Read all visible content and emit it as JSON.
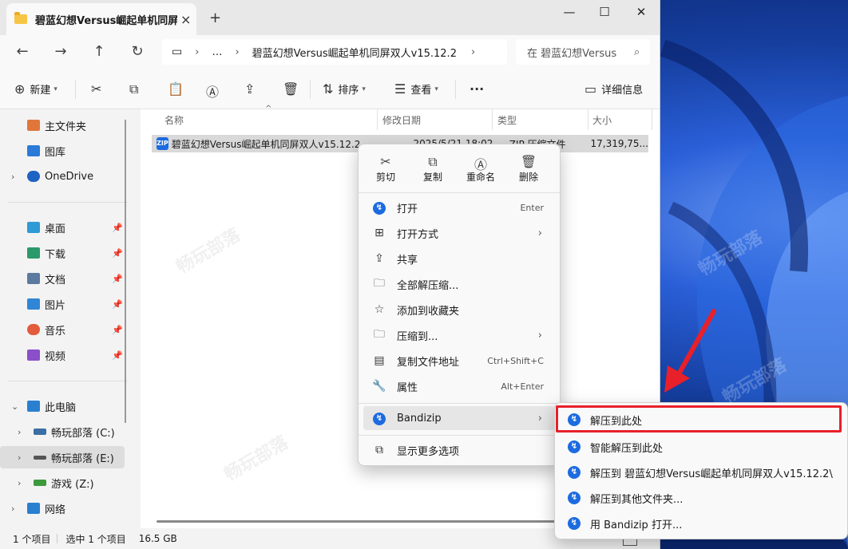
{
  "window": {
    "tab_title": "碧蓝幻想Versus崛起单机同屏双",
    "tab_close": "×",
    "new_tab": "+",
    "minimize": "—",
    "maximize": "☐",
    "close": "✕"
  },
  "address": {
    "ellipsis": "…",
    "path": "碧蓝幻想Versus崛起单机同屏双人v15.12.2",
    "search_placeholder": "在 碧蓝幻想Versus"
  },
  "toolbar": {
    "new_label": "新建",
    "sort_label": "排序",
    "view_label": "查看",
    "more": "···",
    "details_label": "详细信息"
  },
  "sidebar": {
    "items": [
      {
        "label": "主文件夹",
        "color": "#e0763a"
      },
      {
        "label": "图库",
        "color": "#2b7ad8"
      },
      {
        "label": "OneDrive",
        "color": "#1e63c4"
      },
      {
        "label": "桌面",
        "color": "#2e9ad6"
      },
      {
        "label": "下载",
        "color": "#2a9a6a"
      },
      {
        "label": "文档",
        "color": "#5c7aa0"
      },
      {
        "label": "图片",
        "color": "#2f86d6"
      },
      {
        "label": "音乐",
        "color": "#e25b3d"
      },
      {
        "label": "视频",
        "color": "#8a4fc9"
      },
      {
        "label": "此电脑",
        "color": "#2a7fd0"
      },
      {
        "label": "畅玩部落 (C:)",
        "color": "#3b6ea5"
      },
      {
        "label": "畅玩部落 (E:)",
        "color": "#555555"
      },
      {
        "label": "游戏 (Z:)",
        "color": "#3c9a3c"
      },
      {
        "label": "网络",
        "color": "#2a7fd0"
      }
    ]
  },
  "columns": {
    "name": "名称",
    "modified": "修改日期",
    "type": "类型",
    "size": "大小"
  },
  "file": {
    "name": "碧蓝幻想Versus崛起单机同屏双人v15.12.2",
    "modified": "2025/5/21 18:02",
    "type": "ZIP 压缩文件",
    "size": "17,319,75..."
  },
  "status": {
    "count": "1 个项目",
    "selected": "选中 1 个项目",
    "size": "16.5 GB"
  },
  "context_menu": {
    "quick": [
      {
        "label": "剪切",
        "icon": "scissors-icon"
      },
      {
        "label": "复制",
        "icon": "copy-icon"
      },
      {
        "label": "重命名",
        "icon": "rename-icon"
      },
      {
        "label": "删除",
        "icon": "trash-icon"
      }
    ],
    "items": [
      {
        "label": "打开",
        "shortcut": "Enter"
      },
      {
        "label": "打开方式",
        "shortcut": ""
      },
      {
        "label": "共享",
        "shortcut": ""
      },
      {
        "label": "全部解压缩...",
        "shortcut": ""
      },
      {
        "label": "添加到收藏夹",
        "shortcut": ""
      },
      {
        "label": "压缩到...",
        "shortcut": ""
      },
      {
        "label": "复制文件地址",
        "shortcut": "Ctrl+Shift+C"
      },
      {
        "label": "属性",
        "shortcut": "Alt+Enter"
      },
      {
        "label": "Bandizip",
        "shortcut": ""
      },
      {
        "label": "显示更多选项",
        "shortcut": ""
      }
    ]
  },
  "submenu": {
    "items": [
      "解压到此处",
      "智能解压到此处",
      "解压到 碧蓝幻想Versus崛起单机同屏双人v15.12.2\\",
      "解压到其他文件夹...",
      "用 Bandizip 打开..."
    ]
  },
  "colors": {
    "highlight_box": "#e8202a",
    "bandizip_blue": "#1c6be0"
  }
}
